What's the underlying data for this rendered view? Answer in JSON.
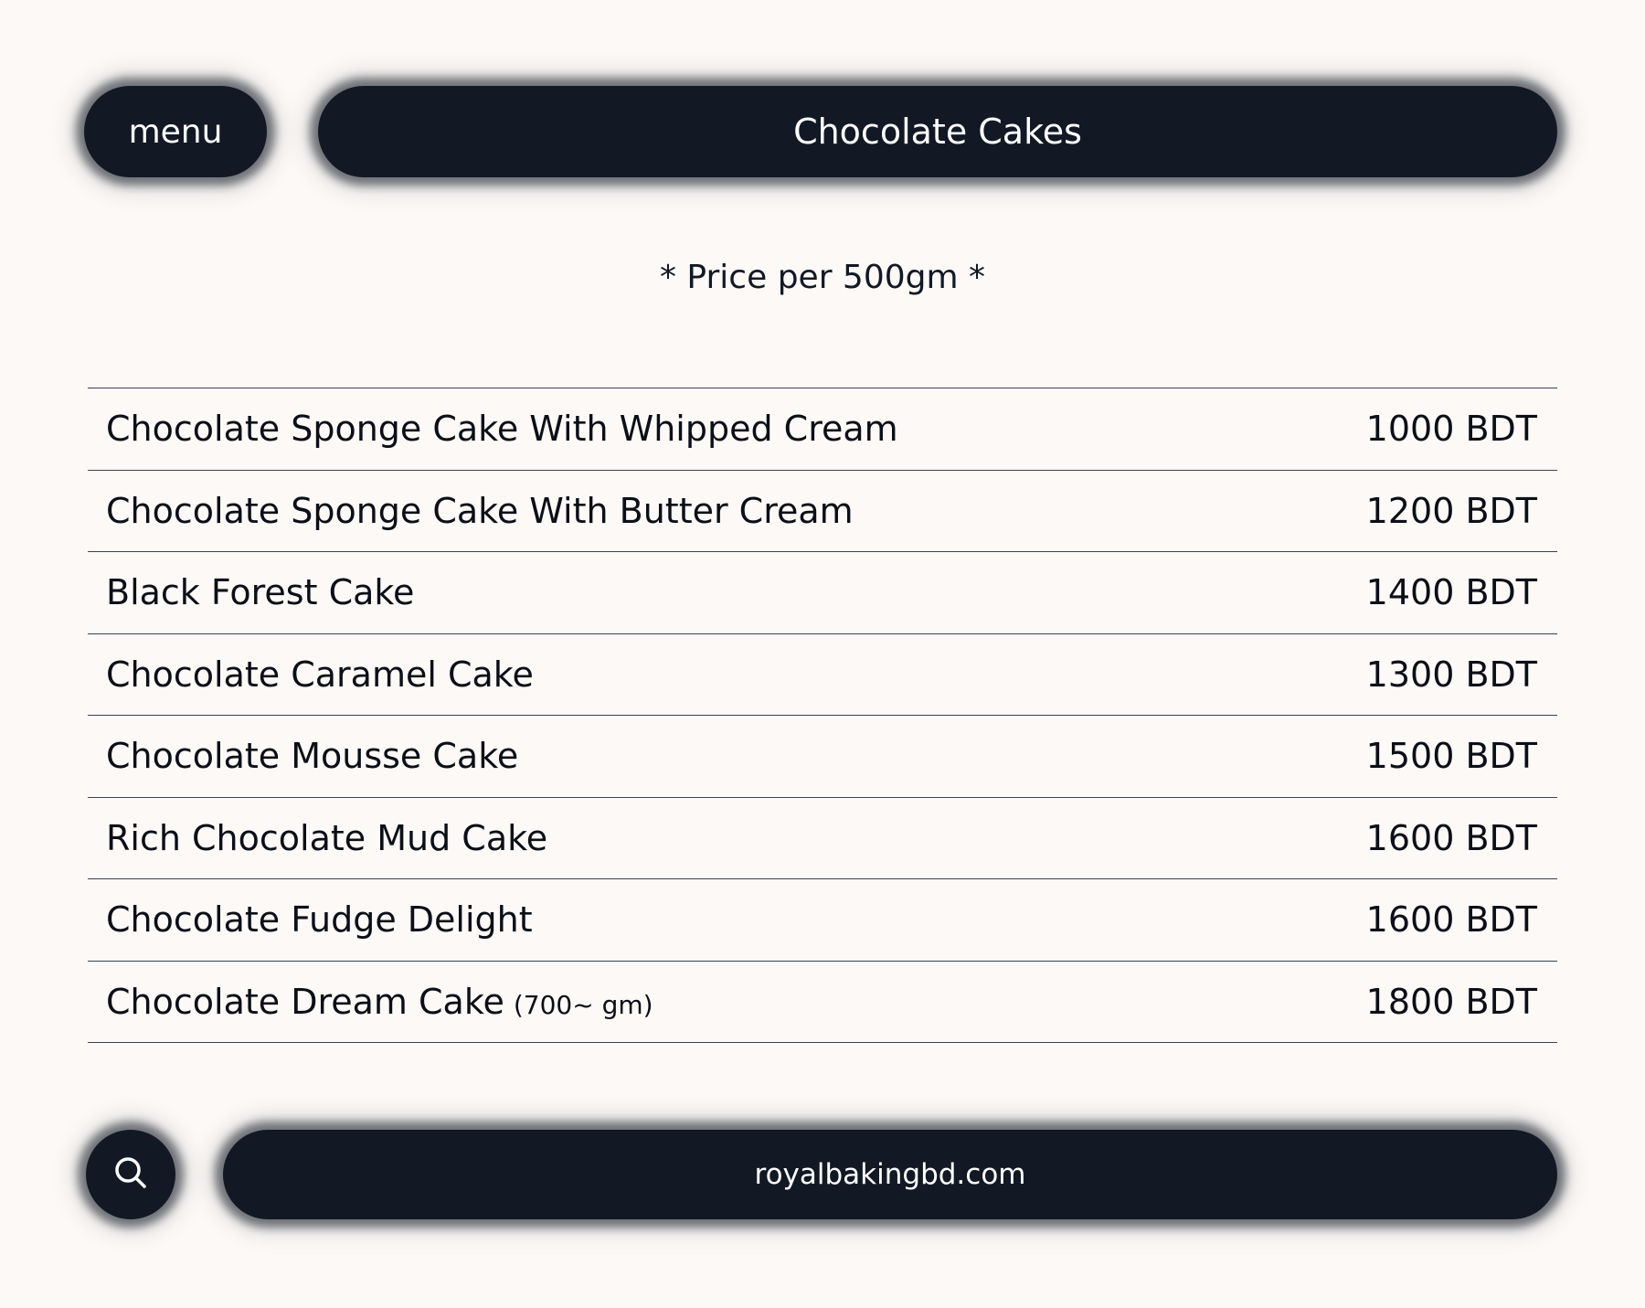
{
  "header": {
    "menu_label": "menu",
    "title": "Chocolate Cakes"
  },
  "subtitle": "* Price per 500gm *",
  "items": [
    {
      "name": "Chocolate Sponge Cake With Whipped Cream",
      "note": "",
      "price": "1000 BDT"
    },
    {
      "name": "Chocolate Sponge Cake With Butter Cream",
      "note": "",
      "price": "1200 BDT"
    },
    {
      "name": "Black Forest Cake",
      "note": "",
      "price": "1400 BDT"
    },
    {
      "name": "Chocolate Caramel Cake",
      "note": "",
      "price": "1300 BDT"
    },
    {
      "name": "Chocolate Mousse Cake",
      "note": "",
      "price": "1500 BDT"
    },
    {
      "name": "Rich Chocolate Mud Cake",
      "note": "",
      "price": "1600 BDT"
    },
    {
      "name": "Chocolate Fudge Delight",
      "note": "",
      "price": "1600 BDT"
    },
    {
      "name": "Chocolate Dream Cake",
      "note": "(700~ gm)",
      "price": "1800 BDT"
    }
  ],
  "footer": {
    "search_icon": "search-icon",
    "website": "royalbakingbd.com"
  },
  "colors": {
    "background": "#fcf9f7",
    "pill": "#121925",
    "pill_text": "#ffffff",
    "text": "#0b0f17",
    "divider": "#3b4250"
  }
}
